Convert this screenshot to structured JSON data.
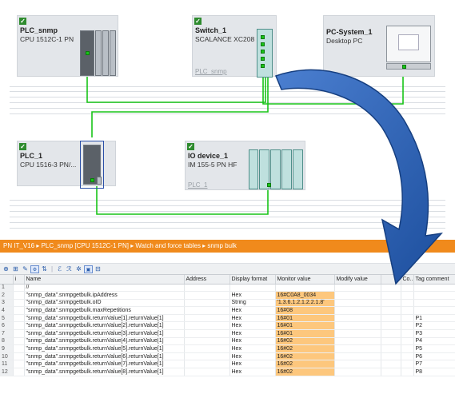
{
  "devices": {
    "plc_snmp": {
      "name": "PLC_snmp",
      "type": "CPU 1512C-1 PN"
    },
    "switch_1": {
      "name": "Switch_1",
      "type": "SCALANCE XC208",
      "network_label": "PLC_snmp"
    },
    "pc_system_1": {
      "name": "PC-System_1",
      "type": "Desktop PC"
    },
    "plc_1": {
      "name": "PLC_1",
      "type": "CPU 1516-3 PN/..."
    },
    "io_device_1": {
      "name": "IO device_1",
      "type": "IM 155-5 PN HF",
      "network_label": "PLC_1"
    }
  },
  "check_glyph": "✓",
  "breadcrumb": "PN IT_V16  ▸  PLC_snmp [CPU 1512C-1 PN]  ▸  Watch and force tables  ▸  snmp bulk",
  "toolbar_icons": [
    "add-row-icon",
    "insert-row-icon",
    "monitor-icon",
    "modify-icon",
    "force-icon",
    "glasses-icon",
    "glasses-all-icon",
    "trigger-icon",
    "display-icon",
    "stop-icon"
  ],
  "table": {
    "headers": {
      "rownum": "",
      "icon": "i",
      "name": "Name",
      "address": "Address",
      "display_format": "Display format",
      "monitor_value": "Monitor value",
      "modify_value": "Modify value",
      "flag": "",
      "comment_short": "Co...",
      "tag_comment": "Tag comment"
    },
    "rows": [
      {
        "num": "1",
        "name": "//",
        "format": "",
        "monitor": "",
        "checkbox": false,
        "comment": ""
      },
      {
        "num": "2",
        "name": "\"snmp_data\".snmpgetbulk.ipAddress",
        "format": "Hex",
        "monitor": "16#C0A8_0034",
        "checkbox": true,
        "comment": ""
      },
      {
        "num": "3",
        "name": "\"snmp_data\".snmpgetbulk.oID",
        "format": "String",
        "monitor": "'1.3.6.1.2.1.2.2.1.8'",
        "checkbox": true,
        "comment": ""
      },
      {
        "num": "4",
        "name": "\"snmp_data\".snmpgetbulk.maxRepetitions",
        "format": "Hex",
        "monitor": "16#08",
        "checkbox": true,
        "comment": ""
      },
      {
        "num": "5",
        "name": "\"snmp_data\".snmpgetbulk.returnValue[1].returnValue[1]",
        "format": "Hex",
        "monitor": "16#01",
        "checkbox": true,
        "comment": "P1"
      },
      {
        "num": "6",
        "name": "\"snmp_data\".snmpgetbulk.returnValue[2].returnValue[1]",
        "format": "Hex",
        "monitor": "16#01",
        "checkbox": true,
        "comment": "P2"
      },
      {
        "num": "7",
        "name": "\"snmp_data\".snmpgetbulk.returnValue[3].returnValue[1]",
        "format": "Hex",
        "monitor": "16#01",
        "checkbox": true,
        "comment": "P3"
      },
      {
        "num": "8",
        "name": "\"snmp_data\".snmpgetbulk.returnValue[4].returnValue[1]",
        "format": "Hex",
        "monitor": "16#02",
        "checkbox": true,
        "comment": "P4"
      },
      {
        "num": "9",
        "name": "\"snmp_data\".snmpgetbulk.returnValue[5].returnValue[1]",
        "format": "Hex",
        "monitor": "16#02",
        "checkbox": true,
        "comment": "P5"
      },
      {
        "num": "10",
        "name": "\"snmp_data\".snmpgetbulk.returnValue[6].returnValue[1]",
        "format": "Hex",
        "monitor": "16#02",
        "checkbox": true,
        "comment": "P6"
      },
      {
        "num": "11",
        "name": "\"snmp_data\".snmpgetbulk.returnValue[7].returnValue[1]",
        "format": "Hex",
        "monitor": "16#02",
        "checkbox": true,
        "comment": "P7"
      },
      {
        "num": "12",
        "name": "\"snmp_data\".snmpgetbulk.returnValue[8].returnValue[1]",
        "format": "Hex",
        "monitor": "16#02",
        "checkbox": true,
        "comment": "P8"
      }
    ]
  },
  "colors": {
    "accent_orange": "#f08a1c",
    "monitor_highlight": "#fdc77d",
    "link_green": "#18c418",
    "arrow_blue": "#2b5fb0"
  }
}
